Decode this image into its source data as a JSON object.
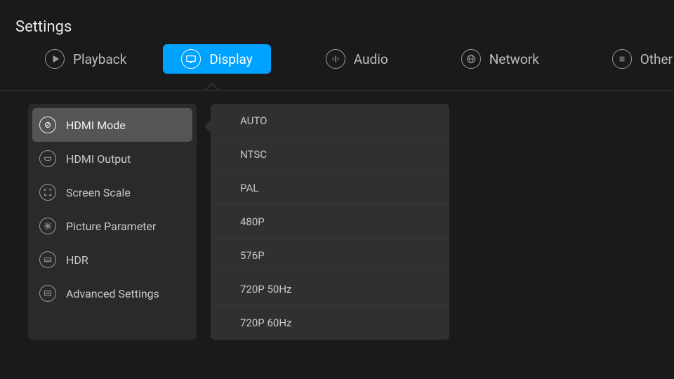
{
  "title": "Settings",
  "colors": {
    "accent": "#00a2ff"
  },
  "tabs": [
    {
      "id": "playback",
      "label": "Playback",
      "icon": "play-icon"
    },
    {
      "id": "display",
      "label": "Display",
      "icon": "monitor-icon",
      "active": true
    },
    {
      "id": "audio",
      "label": "Audio",
      "icon": "equalizer-icon"
    },
    {
      "id": "network",
      "label": "Network",
      "icon": "globe-icon"
    },
    {
      "id": "other",
      "label": "Other",
      "icon": "list-icon"
    }
  ],
  "sidebar": {
    "items": [
      {
        "label": "HDMI Mode",
        "icon": "hdmi-mode-icon",
        "selected": true
      },
      {
        "label": "HDMI Output",
        "icon": "hdmi-output-icon"
      },
      {
        "label": "Screen Scale",
        "icon": "scale-icon"
      },
      {
        "label": "Picture Parameter",
        "icon": "snowflake-icon"
      },
      {
        "label": "HDR",
        "icon": "hdr-icon"
      },
      {
        "label": "Advanced Settings",
        "icon": "advanced-icon"
      }
    ]
  },
  "options": [
    {
      "label": "AUTO"
    },
    {
      "label": "NTSC"
    },
    {
      "label": "PAL"
    },
    {
      "label": "480P"
    },
    {
      "label": "576P"
    },
    {
      "label": "720P  50Hz"
    },
    {
      "label": "720P  60Hz"
    }
  ]
}
